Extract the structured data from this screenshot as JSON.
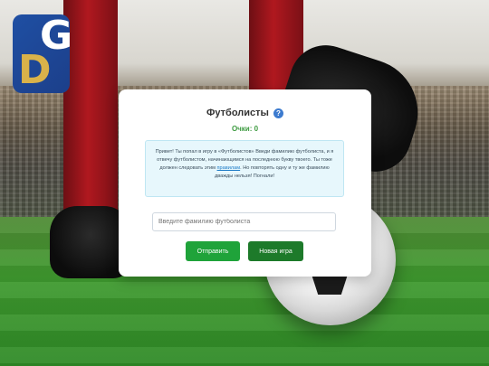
{
  "logo": {
    "letter_top": "G",
    "letter_bottom": "D"
  },
  "game": {
    "title": "Футболисты",
    "help_icon": "?",
    "score_label": "Очки: 0"
  },
  "info": {
    "text_before_link": "Привет! Ты попал в игру в «Футболистов» Введи фамилию футболиста, и я отвечу футболистом, начинающимся на последнюю букву твоего. Ты тоже должен следовать этим ",
    "link_text": "правилам",
    "text_after_link": ". Но повторять одну и ту же фамилию дважды нельзя! Погнали!"
  },
  "search": {
    "placeholder": "Введите фамилию футболиста",
    "value": ""
  },
  "buttons": {
    "send_label": "Отправить",
    "new_game_label": "Новая игра"
  },
  "colors": {
    "primary_green": "#1fa33a",
    "dark_green": "#1d7a2a",
    "score_green": "#3c9a3f",
    "info_bg": "#e7f7fc",
    "logo_blue": "#1f4fa3",
    "logo_gold": "#d9b24a"
  }
}
